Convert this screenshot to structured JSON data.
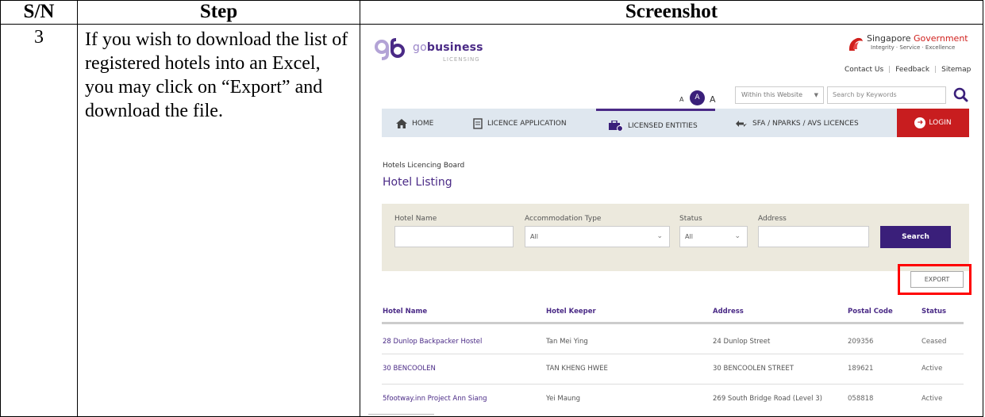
{
  "doc": {
    "headers": {
      "sn": "S/N",
      "step": "Step",
      "screenshot": "Screenshot"
    },
    "row": {
      "sn": "3",
      "step": "If you wish to download the list of registered hotels into an Excel, you may click on “Export” and download the file."
    }
  },
  "site": {
    "logo_go": "go",
    "logo_business": "business",
    "logo_sub": "LICENSING",
    "gov_name_1": "Singapore",
    "gov_name_2": "Government",
    "gov_tagline": "Integrity · Service · Excellence",
    "top_links": [
      "Contact Us",
      "Feedback",
      "Sitemap"
    ],
    "font_sizes": [
      "A",
      "A",
      "A"
    ],
    "scope_select": "Within this Website",
    "search_placeholder": "Search by Keywords",
    "nav": [
      "HOME",
      "LICENCE APPLICATION",
      "LICENSED ENTITIES",
      "SFA / NPARKS / AVS LICENCES"
    ],
    "login": "LOGIN",
    "breadcrumb": "Hotels Licencing Board",
    "page_title": "Hotel Listing",
    "filters": {
      "hotel_name_label": "Hotel Name",
      "accommodation_label": "Accommodation Type",
      "accommodation_value": "All",
      "status_label": "Status",
      "status_value": "All",
      "address_label": "Address",
      "search_button": "Search"
    },
    "export_button": "EXPORT",
    "table": {
      "columns": [
        "Hotel Name",
        "Hotel Keeper",
        "Address",
        "Postal Code",
        "Status"
      ],
      "rows": [
        {
          "name": "28 Dunlop Backpacker Hostel",
          "keeper": "Tan Mei Ying",
          "address": "24 Dunlop Street",
          "postal": "209356",
          "status": "Ceased"
        },
        {
          "name": "30 BENCOOLEN",
          "keeper": "TAN KHENG HWEE",
          "address": "30 BENCOOLEN STREET",
          "postal": "189621",
          "status": "Active"
        },
        {
          "name": "5footway.inn Project Ann Siang",
          "keeper": "Yei Maung",
          "address": "269 South Bridge Road (Level 3)",
          "postal": "058818",
          "status": "Active"
        }
      ]
    }
  },
  "colors": {
    "brand_purple": "#4a2a86",
    "login_red": "#c81d1f",
    "highlight_red": "#ff0000",
    "filter_bg": "#ece9dd",
    "nav_bg": "#dfe7ef"
  }
}
